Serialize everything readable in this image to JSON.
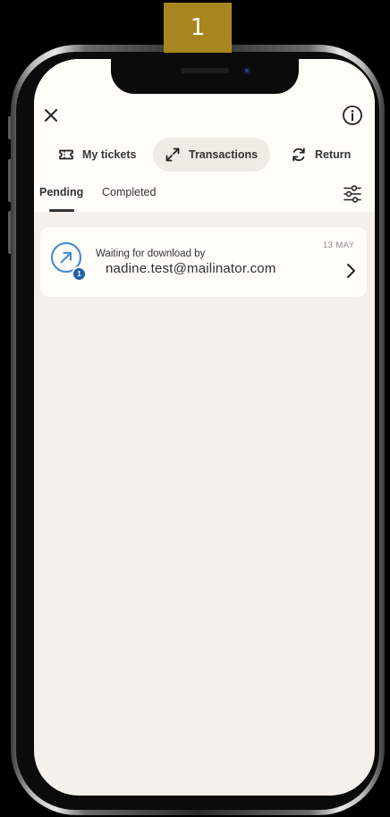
{
  "step_badge": "1",
  "header": {
    "close_icon": "close-icon",
    "info_icon": "info-icon"
  },
  "tabs": [
    {
      "label": "My tickets",
      "icon": "ticket-icon",
      "active": false
    },
    {
      "label": "Transactions",
      "icon": "transfer-arrows-icon",
      "active": true
    },
    {
      "label": "Return",
      "icon": "refresh-icon",
      "active": false
    }
  ],
  "subtabs": [
    {
      "label": "Pending",
      "active": true
    },
    {
      "label": "Completed",
      "active": false
    }
  ],
  "filter_icon": "filter-sliders-icon",
  "transactions": [
    {
      "title": "Waiting for download by",
      "email": "nadine.test@mailinator.com",
      "date": "13 MAY",
      "count_badge": "1",
      "icon": "arrow-up-right-circle-icon"
    }
  ],
  "colors": {
    "screen_bg": "#f4f0eb",
    "header_bg": "#fffdf8",
    "accent_blue": "#1f5fa8",
    "step_badge_bg": "#a8861f"
  }
}
